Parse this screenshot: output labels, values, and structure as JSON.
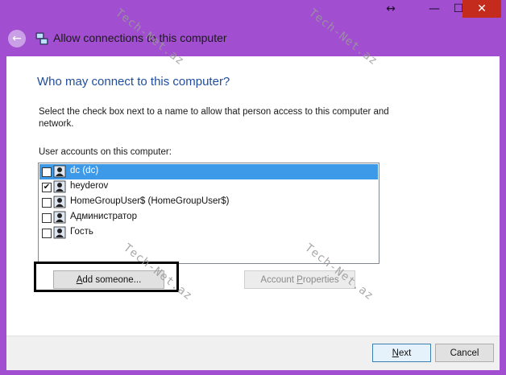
{
  "window": {
    "title": "Allow connections to this computer",
    "controls": {
      "resize": "↔",
      "minimize": "—",
      "maximize": "☐",
      "close": "✕"
    }
  },
  "heading": "Who may connect to this computer?",
  "description": "Select the check box next to a name to allow that person access to this computer and network.",
  "list_label": "User accounts on this computer:",
  "users": [
    {
      "name": "dc (dc)",
      "checked": false,
      "selected": true
    },
    {
      "name": "heyderov",
      "checked": true,
      "selected": false
    },
    {
      "name": "HomeGroupUser$ (HomeGroupUser$)",
      "checked": false,
      "selected": false
    },
    {
      "name": "Администратор",
      "checked": false,
      "selected": false
    },
    {
      "name": "Гость",
      "checked": false,
      "selected": false
    }
  ],
  "buttons": {
    "add_someone": {
      "prefix": "",
      "accel": "A",
      "rest": "dd someone..."
    },
    "account_properties": {
      "prefix": "Account ",
      "accel": "P",
      "rest": "roperties"
    },
    "next": {
      "prefix": "",
      "accel": "N",
      "rest": "ext"
    },
    "cancel": {
      "label": "Cancel"
    }
  },
  "watermark": "Tech-Net.az",
  "colors": {
    "frame": "#a14ed0",
    "heading": "#1f4d9e",
    "selection": "#3c9ae8",
    "close": "#c42b1c"
  },
  "icons": [
    "back-arrow-icon",
    "network-computer-icon",
    "user-icon",
    "checkbox-icon"
  ]
}
